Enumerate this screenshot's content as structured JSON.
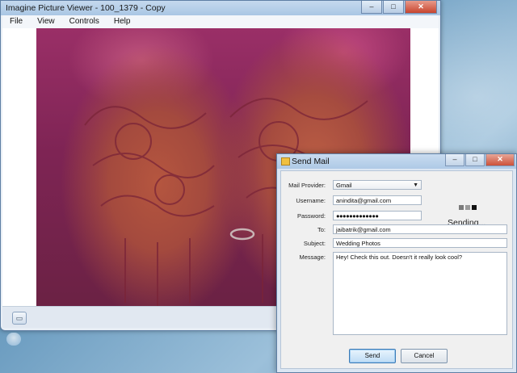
{
  "viewer": {
    "title": "Imagine Picture Viewer - 100_1379 - Copy",
    "window_buttons": [
      "–",
      "□",
      "✕"
    ],
    "menu": [
      "File",
      "View",
      "Controls",
      "Help"
    ]
  },
  "dialog": {
    "title": "Send Mail",
    "window_buttons": [
      "–",
      "□",
      "✕"
    ],
    "labels": {
      "provider": "Mail Provider:",
      "username": "Username:",
      "password": "Password:",
      "to": "To:",
      "subject": "Subject:",
      "message": "Message:"
    },
    "values": {
      "provider": "Gmail",
      "username": "anindita@gmail.com",
      "password": "●●●●●●●●●●●●●",
      "to": "jaibatrik@gmail.com",
      "subject": "Wedding Photos",
      "message": "Hey! Check this out. Doesn't it really look cool?"
    },
    "status": "Sending...",
    "progress_dot_colors": [
      "#7a7a7a",
      "#9a9a9a",
      "#111111"
    ],
    "buttons": {
      "send": "Send",
      "cancel": "Cancel"
    }
  }
}
